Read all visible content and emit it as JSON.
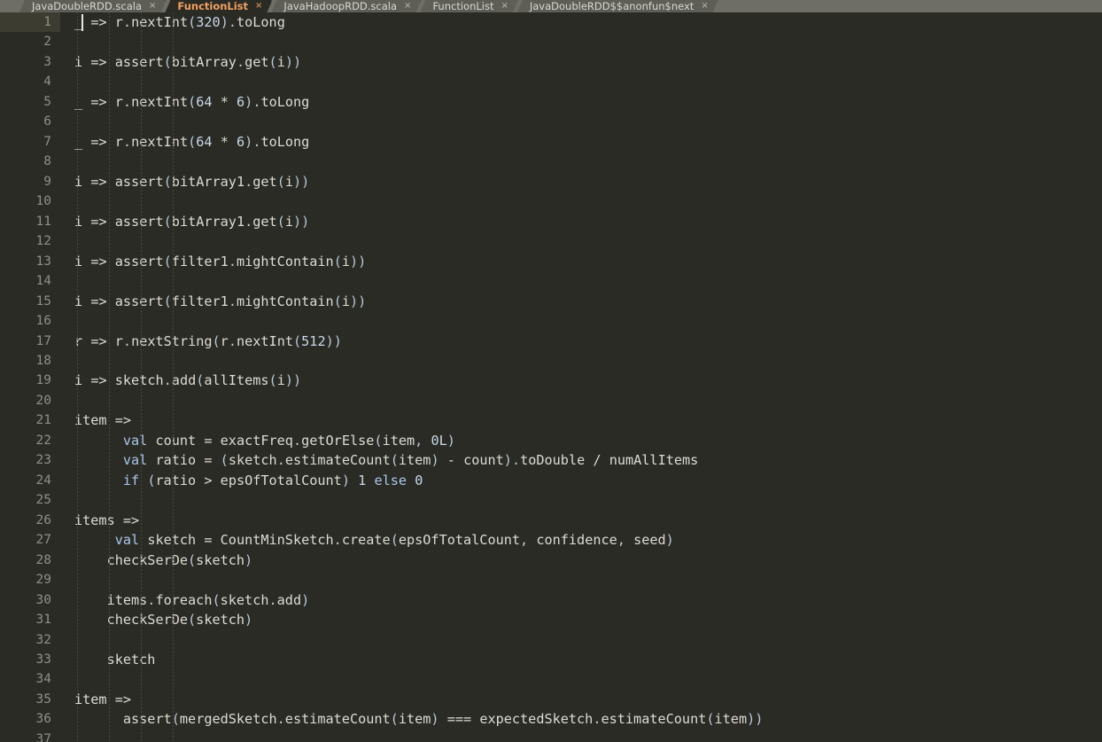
{
  "window": {
    "background_color": "#2b2b26",
    "tabbar_color": "#6e6e66",
    "active_tab_color": "#f0a060"
  },
  "tabbar": {
    "tabs": [
      {
        "label": "JavaDoubleRDD.scala",
        "close_glyph": "×",
        "active": false
      },
      {
        "label": "FunctionList",
        "close_glyph": "×",
        "active": true
      },
      {
        "label": "JavaHadoopRDD.scala",
        "close_glyph": "×",
        "active": false
      },
      {
        "label": "FunctionList",
        "close_glyph": "×",
        "active": false
      },
      {
        "label": "JavaDoubleRDD$$anonfun$next",
        "close_glyph": "×",
        "active": false
      }
    ]
  },
  "editor": {
    "current_line": 1,
    "caret_line": 1,
    "lines": [
      {
        "n": "1",
        "text": "_ => r.nextInt(320).toLong"
      },
      {
        "n": "2",
        "text": ""
      },
      {
        "n": "3",
        "text": "i => assert(bitArray.get(i))"
      },
      {
        "n": "4",
        "text": ""
      },
      {
        "n": "5",
        "text": "_ => r.nextInt(64 * 6).toLong"
      },
      {
        "n": "6",
        "text": ""
      },
      {
        "n": "7",
        "text": "_ => r.nextInt(64 * 6).toLong"
      },
      {
        "n": "8",
        "text": ""
      },
      {
        "n": "9",
        "text": "i => assert(bitArray1.get(i))"
      },
      {
        "n": "10",
        "text": ""
      },
      {
        "n": "11",
        "text": "i => assert(bitArray1.get(i))"
      },
      {
        "n": "12",
        "text": ""
      },
      {
        "n": "13",
        "text": "i => assert(filter1.mightContain(i))"
      },
      {
        "n": "14",
        "text": ""
      },
      {
        "n": "15",
        "text": "i => assert(filter1.mightContain(i))"
      },
      {
        "n": "16",
        "text": ""
      },
      {
        "n": "17",
        "text": "r => r.nextString(r.nextInt(512))"
      },
      {
        "n": "18",
        "text": ""
      },
      {
        "n": "19",
        "text": "i => sketch.add(allItems(i))"
      },
      {
        "n": "20",
        "text": ""
      },
      {
        "n": "21",
        "text": "item =>"
      },
      {
        "n": "22",
        "text": "      val count = exactFreq.getOrElse(item, 0L)"
      },
      {
        "n": "23",
        "text": "      val ratio = (sketch.estimateCount(item) - count).toDouble / numAllItems"
      },
      {
        "n": "24",
        "text": "      if (ratio > epsOfTotalCount) 1 else 0"
      },
      {
        "n": "25",
        "text": ""
      },
      {
        "n": "26",
        "text": "items =>"
      },
      {
        "n": "27",
        "text": "     val sketch = CountMinSketch.create(epsOfTotalCount, confidence, seed)"
      },
      {
        "n": "28",
        "text": "    checkSerDe(sketch)"
      },
      {
        "n": "29",
        "text": ""
      },
      {
        "n": "30",
        "text": "    items.foreach(sketch.add)"
      },
      {
        "n": "31",
        "text": "    checkSerDe(sketch)"
      },
      {
        "n": "32",
        "text": ""
      },
      {
        "n": "33",
        "text": "    sketch"
      },
      {
        "n": "34",
        "text": ""
      },
      {
        "n": "35",
        "text": "item =>"
      },
      {
        "n": "36",
        "text": "      assert(mergedSketch.estimateCount(item) === expectedSketch.estimateCount(item))"
      },
      {
        "n": "37",
        "text": ""
      }
    ]
  }
}
